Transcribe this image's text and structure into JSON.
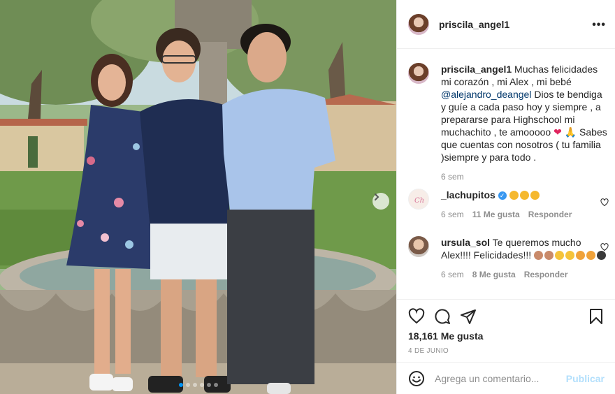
{
  "post": {
    "author": "priscila_angel1",
    "caption": {
      "username": "priscila_angel1",
      "text_part1": " Muchas felicidades mi corazón , mi Alex , mi bebé ",
      "mention": "@alejandro_deangel",
      "text_part2": " Dios te bendiga y guíe a cada paso hoy y siempre , a prepararse para Highschool mi muchachito , te amooooo ",
      "text_part3": " Sabes que cuentas con nosotros ( tu familia )siempre y para todo .",
      "time": "6 sem"
    },
    "comments": [
      {
        "username": "_lachupitos",
        "verified": true,
        "text": "",
        "time": "6 sem",
        "likes": "11 Me gusta",
        "reply": "Responder"
      },
      {
        "username": "ursula_sol",
        "verified": false,
        "text": " Te queremos mucho Alex!!!! Felicidades!!! ",
        "time": "6 sem",
        "likes": "8 Me gusta",
        "reply": "Responder"
      }
    ],
    "like_count": "18,161 Me gusta",
    "date": "4 DE JUNIO",
    "comment_placeholder": "Agrega un comentario...",
    "publish_label": "Publicar",
    "carousel": {
      "slides": 6,
      "current": 1
    }
  },
  "icons": {
    "more": "more-options-icon",
    "heart": "heart-icon",
    "comment": "comment-icon",
    "share": "share-icon",
    "save": "bookmark-icon",
    "emoji": "emoji-icon",
    "next": "chevron-right-icon"
  },
  "colors": {
    "mention": "#00376b",
    "muted": "#8e8e8e",
    "publish_disabled": "#b2dffc",
    "carousel_active": "#0095f6"
  }
}
